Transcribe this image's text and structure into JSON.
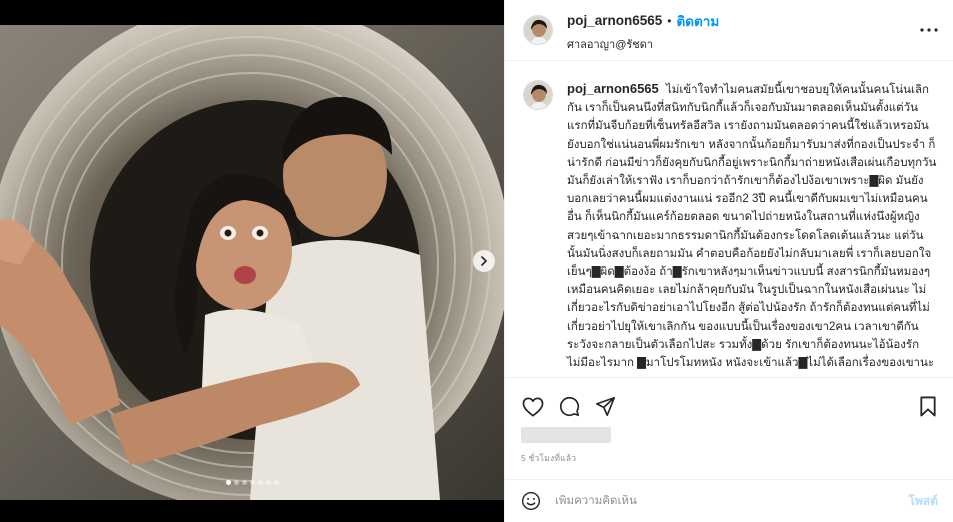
{
  "post": {
    "username": "poj_arnon6565",
    "separator": "•",
    "follow_label": "ติดตาม",
    "location": "ศาลอาญา@รัชดา",
    "caption": "ไม่เข้าใจทำไมคนสมัยนี้เขาชอบยุให้คนนั้นคนโน่นเลิกกัน เราก็เป็นคนนึงที่สนิทกับนิกกี้แล้วก็เจอกับมันมาตลอดเห็นมันตั้งแต่วันแรกที่มันจีบก้อยที่เซ็นทรัลอีสวิล เรายังถามมันตลอดว่าคนนี้ใช่แล้วเหรอมันยังบอกใช่แน่นอนพี่ผมรักเขา หลังจากนั้นก้อยก็มารับมาส่งที่กองเป็นประจำ ก็น่ารักดี ก่อนมีข่าวก็ยังคุยกับนิกกี้อยู่เพราะนิกกี้มาถ่ายหนังเสือเผ่นเกือบทุกวัน มันก็ยังเล่าให้เราฟัง เราก็บอกว่าถ้ารักเขาก็ต้องไปง้อเขาเพราะ▇ผิด มันยังบอกเลยว่าคนนี้ผมแต่งงานแน่ รออีก2 3ปี คนนี้เขาดีกับผมเขาไม่เหมือนคนอื่น ก็เห็นนิกกี้มันแคร์ก้อยตลอด ขนาดไปถ่ายหนังในสถานที่แห่งนึงผู้หญิงสวยๆเข้าฉากเยอะมากธรรมดานิกกี้มันต้องกระโดดโลดเต้นแล้วนะ แต่วันนั้นมันนิ่งสงบก็เลยถามมัน คำตอบคือก้อยยังไม่กลับมาเลยพี่ เราก็เลยบอกใจเย็นๆ▇ผิด▇ต้องง้อ ถ้า▇รักเขาหลังๆมาเห็นข่าวแบบนี้ สงสารนิกกี้มันหมองๆเหมือนคนคิดเยอะ เลยไม่กล้าคุยกับมัน ในรูปเป็นฉากในหนังเสือเผ่นนะ ไม่เกี่ยวอะไรกับดิข่าอย่าเอาไปโยงอีก สู้ต่อไปน้องรัก ถ้ารักก็ต้องทนแต่คนที่ไม่เกี่ยวอย่าไปยุให้เขาเลิกกัน ของแบบนี้เป็นเรื่องของเขา2คน เวลาเขาดีกันระวังจะกลายเป็นตัวเลือกไปสะ รวมทั้ง▇ด้วย รักเขาก็ต้องทนนะไอ้น้องรัก ไม่มีอะไรมาก ▇มาโปรโมทหนัง หนังจะเข้าแล้ว▇ไม่ได้เลือกเรื่องของเขานะ",
    "time_ago": "5 ชั่วโมงที่แล้ว"
  },
  "comment_box": {
    "placeholder": "เพิ่มความคิดเห็น",
    "post_label": "โพสต์"
  },
  "carousel": {
    "slides": 7,
    "active_index": 1
  },
  "icons": {
    "more": "more-horizontal-icon",
    "like": "heart-icon",
    "comment": "comment-icon",
    "share": "paper-plane-icon",
    "save": "bookmark-icon",
    "emoji": "smiley-icon",
    "next": "chevron-right-icon"
  },
  "colors": {
    "accent": "#0095f6",
    "post_disabled": "#b2dffc",
    "muted": "#8e8e8e"
  }
}
